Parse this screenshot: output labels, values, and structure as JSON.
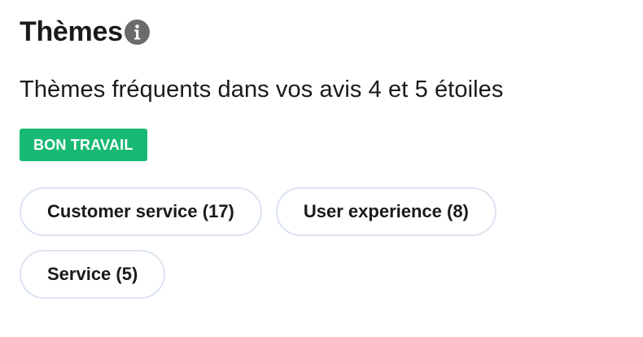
{
  "header": {
    "title": "Thèmes",
    "info_icon": "info-icon"
  },
  "subtitle": "Thèmes fréquents dans vos avis 4 et 5 étoiles",
  "badge": {
    "label": "BON TRAVAIL",
    "color": "#18b972"
  },
  "topics": [
    {
      "label": "Customer service (17)"
    },
    {
      "label": "User experience (8)"
    },
    {
      "label": "Service (5)"
    }
  ],
  "colors": {
    "chip_border": "#dbe4f0",
    "info_icon_bg": "#6b6b6b",
    "text": "#1a1a1a"
  }
}
